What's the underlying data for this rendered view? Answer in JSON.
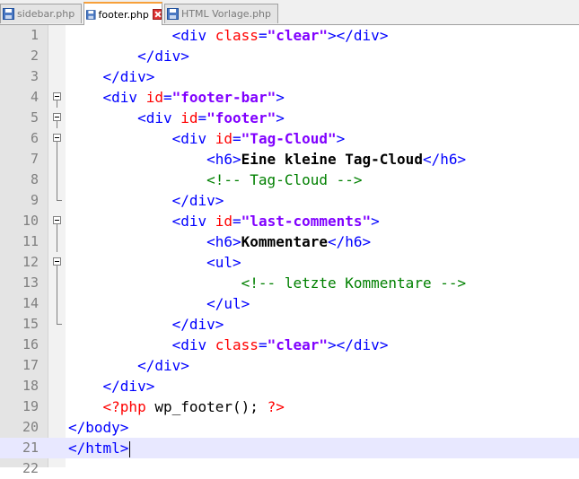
{
  "tabs": [
    {
      "label": "sidebar.php",
      "active": false
    },
    {
      "label": "footer.php",
      "active": true
    },
    {
      "label": "HTML Vorlage.php",
      "active": false
    }
  ],
  "lines": [
    {
      "number": "1",
      "tokens": [
        [
          "tag",
          "<div "
        ],
        [
          "attr",
          "class"
        ],
        [
          "tag",
          "="
        ],
        [
          "str",
          "\"clear\""
        ],
        [
          "tag",
          "></div>"
        ]
      ],
      "indent": 12
    },
    {
      "number": "2",
      "tokens": [
        [
          "tag",
          "</div>"
        ]
      ],
      "indent": 8
    },
    {
      "number": "3",
      "tokens": [
        [
          "tag",
          "</div>"
        ]
      ],
      "indent": 4
    },
    {
      "number": "4",
      "tokens": [
        [
          "tag",
          "<div "
        ],
        [
          "attr",
          "id"
        ],
        [
          "tag",
          "="
        ],
        [
          "str",
          "\"footer-bar\""
        ],
        [
          "tag",
          ">"
        ]
      ],
      "indent": 4
    },
    {
      "number": "5",
      "tokens": [
        [
          "tag",
          "<div "
        ],
        [
          "attr",
          "id"
        ],
        [
          "tag",
          "="
        ],
        [
          "str",
          "\"footer\""
        ],
        [
          "tag",
          ">"
        ]
      ],
      "indent": 8
    },
    {
      "number": "6",
      "tokens": [
        [
          "tag",
          "<div "
        ],
        [
          "attr",
          "id"
        ],
        [
          "tag",
          "="
        ],
        [
          "str",
          "\"Tag-Cloud\""
        ],
        [
          "tag",
          ">"
        ]
      ],
      "indent": 12
    },
    {
      "number": "7",
      "tokens": [
        [
          "tag",
          "<h6>"
        ],
        [
          "txt",
          "Eine kleine Tag-Cloud"
        ],
        [
          "tag",
          "</h6>"
        ]
      ],
      "indent": 16
    },
    {
      "number": "8",
      "tokens": [
        [
          "cmt",
          "<!-- Tag-Cloud -->"
        ]
      ],
      "indent": 16
    },
    {
      "number": "9",
      "tokens": [
        [
          "tag",
          "</div>"
        ]
      ],
      "indent": 12
    },
    {
      "number": "10",
      "tokens": [
        [
          "tag",
          "<div "
        ],
        [
          "attr",
          "id"
        ],
        [
          "tag",
          "="
        ],
        [
          "str",
          "\"last-comments\""
        ],
        [
          "tag",
          ">"
        ]
      ],
      "indent": 12
    },
    {
      "number": "11",
      "tokens": [
        [
          "tag",
          "<h6>"
        ],
        [
          "txt",
          "Kommentare"
        ],
        [
          "tag",
          "</h6>"
        ]
      ],
      "indent": 16
    },
    {
      "number": "12",
      "tokens": [
        [
          "tag",
          "<ul>"
        ]
      ],
      "indent": 16
    },
    {
      "number": "13",
      "tokens": [
        [
          "cmt",
          "<!-- letzte Kommentare -->"
        ]
      ],
      "indent": 20
    },
    {
      "number": "14",
      "tokens": [
        [
          "tag",
          "</ul>"
        ]
      ],
      "indent": 16
    },
    {
      "number": "15",
      "tokens": [
        [
          "tag",
          "</div>"
        ]
      ],
      "indent": 12
    },
    {
      "number": "16",
      "tokens": [
        [
          "tag",
          "<div "
        ],
        [
          "attr",
          "class"
        ],
        [
          "tag",
          "="
        ],
        [
          "str",
          "\"clear\""
        ],
        [
          "tag",
          "></div>"
        ]
      ],
      "indent": 12
    },
    {
      "number": "17",
      "tokens": [
        [
          "tag",
          "</div>"
        ]
      ],
      "indent": 8
    },
    {
      "number": "18",
      "tokens": [
        [
          "tag",
          "</div>"
        ]
      ],
      "indent": 4
    },
    {
      "number": "19",
      "tokens": [
        [
          "php",
          "<?php "
        ],
        [
          "txt0",
          "wp_footer(); "
        ],
        [
          "php",
          "?>"
        ]
      ],
      "indent": 4
    },
    {
      "number": "20",
      "tokens": [
        [
          "tag",
          "</body>"
        ]
      ],
      "indent": 0
    },
    {
      "number": "21",
      "tokens": [
        [
          "tag",
          "</html>"
        ]
      ],
      "indent": 0
    },
    {
      "number": "22",
      "tokens": [],
      "indent": 0
    }
  ],
  "current_line": "21",
  "colors": {
    "tag": "#0000ff",
    "attribute": "#ff0000",
    "string": "#8000ff",
    "comment": "#008000",
    "php": "#ff0000",
    "current_line_bg": "#e8e8ff",
    "active_tab_accent": "#f7a03a"
  },
  "icons": {
    "tab_file": "floppy-disk-icon",
    "tab_close": "close-icon",
    "fold": "fold-minus-icon"
  }
}
